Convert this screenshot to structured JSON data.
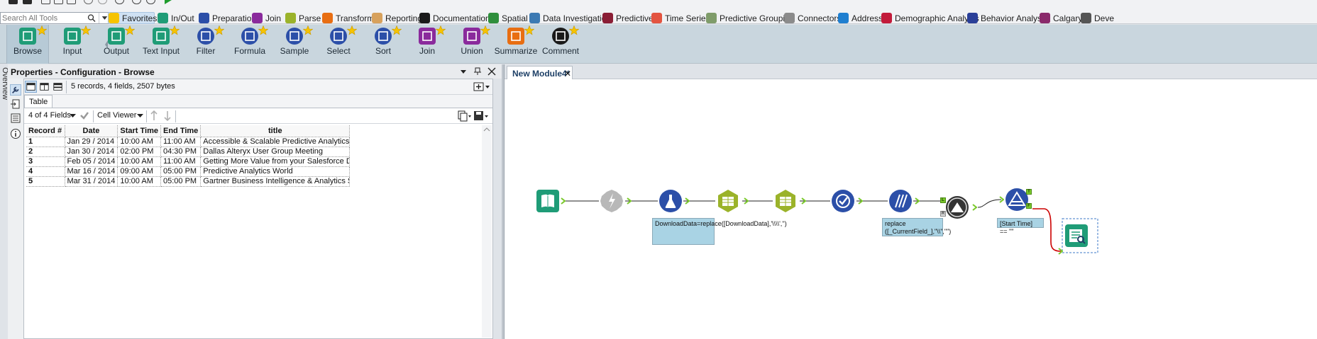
{
  "colors": {
    "accent": "#cfe1f3",
    "palette_bg": "#c9d6de",
    "annotation": "#a9d3e4",
    "connection": "#000000",
    "true_branch": "#cc0000"
  },
  "search": {
    "placeholder": "Search All Tools"
  },
  "categories": [
    {
      "label": "Favorites",
      "icon": "star-icon",
      "color": "#f6c300",
      "active": true
    },
    {
      "label": "In/Out",
      "icon": "book-icon",
      "color": "#1f9c77"
    },
    {
      "label": "Preparation",
      "icon": "flask-icon",
      "color": "#2c4fa8"
    },
    {
      "label": "Join",
      "icon": "join-icon",
      "color": "#8a2a9c"
    },
    {
      "label": "Parse",
      "icon": "parse-icon",
      "color": "#9bb32a"
    },
    {
      "label": "Transform",
      "icon": "sigma-icon",
      "color": "#e86e12"
    },
    {
      "label": "Reporting",
      "icon": "report-icon",
      "color": "#d7a15c"
    },
    {
      "label": "Documentation",
      "icon": "comment-icon",
      "color": "#1a1a1a"
    },
    {
      "label": "Spatial",
      "icon": "spatial-icon",
      "color": "#2f8f3c"
    },
    {
      "label": "Data Investigation",
      "icon": "investigation-icon",
      "color": "#3c7ab3"
    },
    {
      "label": "Predictive",
      "icon": "predictive-icon",
      "color": "#8a1e35"
    },
    {
      "label": "Time Series",
      "icon": "time-series-icon",
      "color": "#e35440"
    },
    {
      "label": "Predictive Grouping",
      "icon": "grouping-icon",
      "color": "#7f9c6a"
    },
    {
      "label": "Connectors",
      "icon": "connectors-icon",
      "color": "#8b8b8b"
    },
    {
      "label": "Address",
      "icon": "address-icon",
      "color": "#1f7fd0"
    },
    {
      "label": "Demographic Analysis",
      "icon": "demographic-icon",
      "color": "#c21b3a"
    },
    {
      "label": "Behavior Analysis",
      "icon": "behavior-icon",
      "color": "#2a3f98"
    },
    {
      "label": "Calgary",
      "icon": "calgary-icon",
      "color": "#8a2a6b"
    },
    {
      "label": "Deve",
      "icon": "developer-icon",
      "color": "#555555"
    }
  ],
  "tools": [
    {
      "label": "Browse",
      "icon": "browse-icon",
      "color": "#1f9c77"
    },
    {
      "label": "Input",
      "icon": "input-icon",
      "color": "#1f9c77"
    },
    {
      "label": "Output",
      "icon": "output-icon",
      "color": "#1f9c77"
    },
    {
      "label": "Text Input",
      "icon": "text-input-icon",
      "color": "#1f9c77"
    },
    {
      "label": "Filter",
      "icon": "filter-icon",
      "color": "#2c4fa8"
    },
    {
      "label": "Formula",
      "icon": "formula-icon",
      "color": "#2c4fa8"
    },
    {
      "label": "Sample",
      "icon": "sample-icon",
      "color": "#2c4fa8"
    },
    {
      "label": "Select",
      "icon": "select-icon",
      "color": "#2c4fa8"
    },
    {
      "label": "Sort",
      "icon": "sort-icon",
      "color": "#2c4fa8"
    },
    {
      "label": "Join",
      "icon": "join-icon",
      "color": "#8a2a9c"
    },
    {
      "label": "Union",
      "icon": "union-icon",
      "color": "#8a2a9c"
    },
    {
      "label": "Summarize",
      "icon": "summarize-icon",
      "color": "#e86e12"
    },
    {
      "label": "Comment",
      "icon": "comment-icon",
      "color": "#1a1a1a"
    }
  ],
  "sidebar": {
    "overview_label": "Overview"
  },
  "properties": {
    "title": "Properties - Configuration - Browse",
    "record_info": "5 records, 4 fields, 2507 bytes",
    "tab_label": "Table",
    "fields_selector": "4 of 4 Fields",
    "viewer_selector": "Cell Viewer",
    "columns": [
      "Record #",
      "Date",
      "Start Time",
      "End Time",
      "title"
    ],
    "rows": [
      [
        "1",
        "Jan 29 / 2014",
        "10:00 AM",
        "11:00 AM",
        "Accessible & Scalable Predictive Analytics Value"
      ],
      [
        "2",
        "Jan 30 / 2014",
        "02:00 PM",
        "04:30 PM",
        "Dallas Alteryx User Group Meeting"
      ],
      [
        "3",
        "Feb 05 / 2014",
        "10:00 AM",
        "11:00 AM",
        "Getting More Value from your Salesforce Data"
      ],
      [
        "4",
        "Mar 16 / 2014",
        "09:00 AM",
        "05:00 PM",
        "Predictive Analytics World"
      ],
      [
        "5",
        "Mar 31 / 2014",
        "10:00 AM",
        "05:00 PM",
        "Gartner Business Intelligence & Analytics  Sum..."
      ]
    ]
  },
  "canvas": {
    "tab_label": "New Module4*",
    "annotations": {
      "formula1": "DownloadData=replace([DownloadData],'\\\\\\\\','')",
      "formula2": "replace ([_CurrentField_],\"\\\\\",\"\")",
      "filter": "[Start Time] == \"\""
    },
    "anchors": {
      "left": "L",
      "right": "R",
      "true": "T",
      "false": "F"
    }
  }
}
